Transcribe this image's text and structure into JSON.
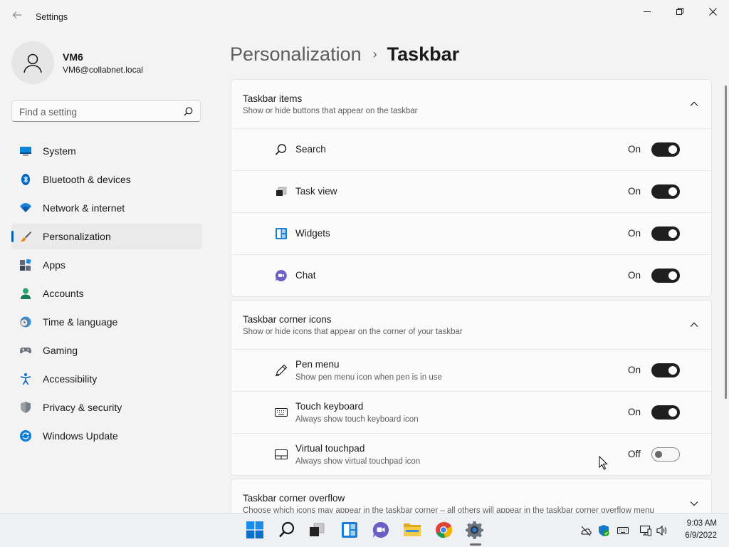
{
  "window": {
    "title": "Settings",
    "back_icon": "arrow-left-icon"
  },
  "user": {
    "name": "VM6",
    "email": "VM6@collabnet.local"
  },
  "search": {
    "placeholder": "Find a setting"
  },
  "nav": {
    "items": [
      {
        "label": "System",
        "icon": "display-icon"
      },
      {
        "label": "Bluetooth & devices",
        "icon": "bluetooth-icon"
      },
      {
        "label": "Network & internet",
        "icon": "wifi-icon"
      },
      {
        "label": "Personalization",
        "icon": "brush-icon",
        "active": true
      },
      {
        "label": "Apps",
        "icon": "apps-icon"
      },
      {
        "label": "Accounts",
        "icon": "person-icon"
      },
      {
        "label": "Time & language",
        "icon": "clock-globe-icon"
      },
      {
        "label": "Gaming",
        "icon": "gamepad-icon"
      },
      {
        "label": "Accessibility",
        "icon": "accessibility-icon"
      },
      {
        "label": "Privacy & security",
        "icon": "shield-icon"
      },
      {
        "label": "Windows Update",
        "icon": "update-icon"
      }
    ]
  },
  "breadcrumb": {
    "parent": "Personalization",
    "separator": "›",
    "current": "Taskbar"
  },
  "sections": {
    "taskbar_items": {
      "title": "Taskbar items",
      "description": "Show or hide buttons that appear on the taskbar",
      "rows": [
        {
          "label": "Search",
          "state": "On",
          "on": true,
          "icon": "search-icon"
        },
        {
          "label": "Task view",
          "state": "On",
          "on": true,
          "icon": "task-view-icon"
        },
        {
          "label": "Widgets",
          "state": "On",
          "on": true,
          "icon": "widgets-icon"
        },
        {
          "label": "Chat",
          "state": "On",
          "on": true,
          "icon": "chat-icon"
        }
      ]
    },
    "corner_icons": {
      "title": "Taskbar corner icons",
      "description": "Show or hide icons that appear on the corner of your taskbar",
      "rows": [
        {
          "label": "Pen menu",
          "sub": "Show pen menu icon when pen is in use",
          "state": "On",
          "on": true,
          "icon": "pen-icon"
        },
        {
          "label": "Touch keyboard",
          "sub": "Always show touch keyboard icon",
          "state": "On",
          "on": true,
          "icon": "keyboard-icon"
        },
        {
          "label": "Virtual touchpad",
          "sub": "Always show virtual touchpad icon",
          "state": "Off",
          "on": false,
          "icon": "touchpad-icon"
        }
      ]
    },
    "corner_overflow": {
      "title": "Taskbar corner overflow",
      "description": "Choose which icons may appear in the taskbar corner – all others will appear in the taskbar corner overflow menu"
    }
  },
  "taskbar": {
    "apps": [
      "start-icon",
      "search-icon",
      "task-view-icon",
      "widgets-icon",
      "chat-icon",
      "file-explorer-icon",
      "chrome-icon",
      "settings-icon"
    ],
    "tray": [
      "onedrive-icon",
      "defender-icon",
      "keyboard-icon",
      "network-icon",
      "volume-icon"
    ],
    "time": "9:03 AM",
    "date": "6/9/2022"
  },
  "colors": {
    "accent": "#005fb8",
    "toggle_on": "#1f1f1f",
    "background": "#f3f3f3",
    "card": "#fbfbfb"
  }
}
